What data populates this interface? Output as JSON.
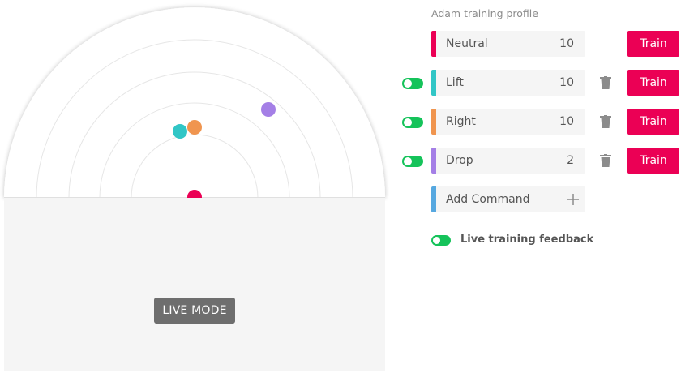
{
  "profile": {
    "title": "Adam training profile"
  },
  "commands": [
    {
      "name": "Neutral",
      "count": "10",
      "color": "#eb0055",
      "toggle": false,
      "deletable": false,
      "train_label": "Train"
    },
    {
      "name": "Lift",
      "count": "10",
      "color": "#31c6c6",
      "toggle": true,
      "deletable": true,
      "train_label": "Train"
    },
    {
      "name": "Right",
      "count": "10",
      "color": "#f0954f",
      "toggle": true,
      "deletable": true,
      "train_label": "Train"
    },
    {
      "name": "Drop",
      "count": "2",
      "color": "#a47fe6",
      "toggle": true,
      "deletable": true,
      "train_label": "Train"
    }
  ],
  "add_command": {
    "label": "Add Command",
    "color": "#56a8e0",
    "icon": "plus-icon"
  },
  "feedback": {
    "label": "Live training feedback",
    "enabled": true
  },
  "live_mode": {
    "label": "LIVE MODE"
  },
  "colors": {
    "accent": "#eb0055",
    "toggle_on": "#15c35a",
    "neutral_dot": "#eb0055",
    "lift_dot": "#31c6c6",
    "right_dot": "#f0954f",
    "drop_dot": "#a47fe6"
  }
}
